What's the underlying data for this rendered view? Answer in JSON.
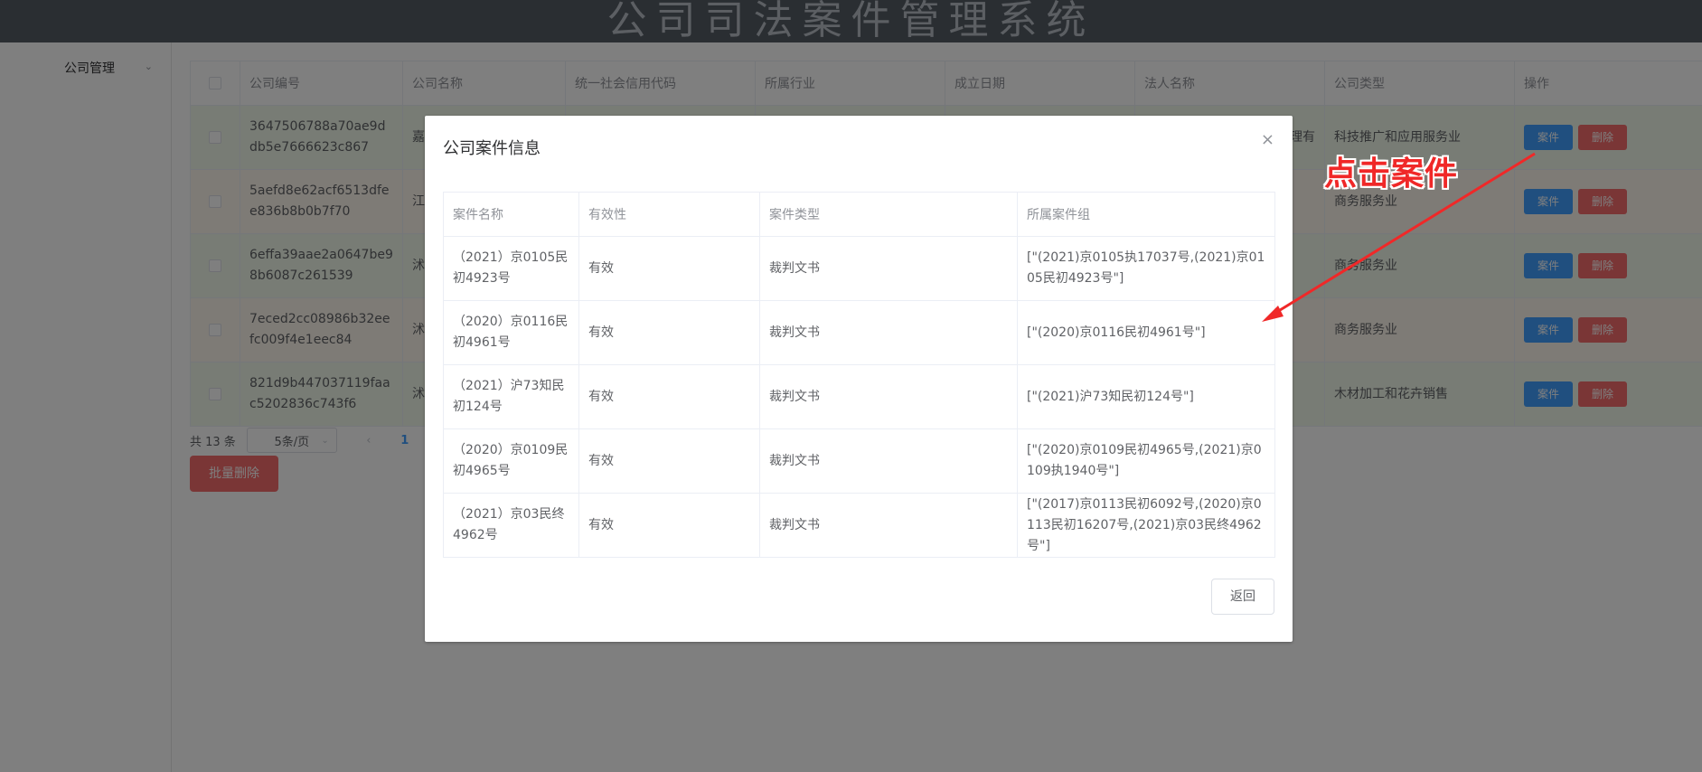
{
  "app": {
    "title": "公司司法案件管理系统"
  },
  "sidebar": {
    "items": [
      {
        "label": "公司管理"
      }
    ]
  },
  "table": {
    "headers": [
      "公司编号",
      "公司名称",
      "统一社会信用代码",
      "所属行业",
      "成立日期",
      "法人名称",
      "公司类型",
      "操作"
    ],
    "rows": [
      {
        "id": "3647506788a70ae9ddb5e7666623c867",
        "name": "嘉 业",
        "code": "",
        "industry": "",
        "date": "",
        "legal": "理有",
        "type": "科技推广和应用服务业"
      },
      {
        "id": "5aefd8e62acf6513dfee836b8b0b7f70",
        "name": "江",
        "code": "",
        "industry": "",
        "date": "",
        "legal": "",
        "type": "商务服务业"
      },
      {
        "id": "6effa39aae2a0647be98b6087c261539",
        "name": "沭 有",
        "code": "",
        "industry": "",
        "date": "",
        "legal": "",
        "type": "商务服务业"
      },
      {
        "id": "7eced2cc08986b32eefc009f4e1eec84",
        "name": "沭 公",
        "code": "",
        "industry": "",
        "date": "",
        "legal": "",
        "type": "商务服务业"
      },
      {
        "id": "821d9b447037119faac5202836c743f6",
        "name": "沭",
        "code": "",
        "industry": "",
        "date": "",
        "legal": "",
        "type": "木材加工和花卉销售"
      }
    ],
    "case_btn": "案件",
    "delete_btn": "删除"
  },
  "pager": {
    "total": "共 13 条",
    "size": "5条/页",
    "prev": "‹",
    "current": "1"
  },
  "batch_delete": "批量删除",
  "dialog": {
    "title": "公司案件信息",
    "close": "×",
    "headers": [
      "案件名称",
      "有效性",
      "案件类型",
      "所属案件组"
    ],
    "rows": [
      {
        "name": "（2021）京0105民初4923号",
        "valid": "有效",
        "type": "裁判文书",
        "group": "[\"(2021)京0105执17037号,(2021)京0105民初4923号\"]"
      },
      {
        "name": "（2020）京0116民初4961号",
        "valid": "有效",
        "type": "裁判文书",
        "group": "[\"(2020)京0116民初4961号\"]"
      },
      {
        "name": "（2021）沪73知民初124号",
        "valid": "有效",
        "type": "裁判文书",
        "group": "[\"(2021)沪73知民初124号\"]"
      },
      {
        "name": "（2020）京0109民初4965号",
        "valid": "有效",
        "type": "裁判文书",
        "group": "[\"(2020)京0109民初4965号,(2021)京0109执1940号\"]"
      },
      {
        "name": "（2021）京03民终4962号",
        "valid": "有效",
        "type": "裁判文书",
        "group": "[\"(2017)京0113民初6092号,(2020)京0113民初16207号,(2021)京03民终4962号\"]"
      }
    ],
    "back_btn": "返回"
  },
  "annotation": {
    "text": "点击案件",
    "color": "#f02828"
  },
  "colors": {
    "header_bg": "#545c64",
    "primary": "#409eff",
    "danger": "#f56c6c",
    "row_success": "#f0f9eb",
    "row_warning": "#fdf6ec"
  }
}
